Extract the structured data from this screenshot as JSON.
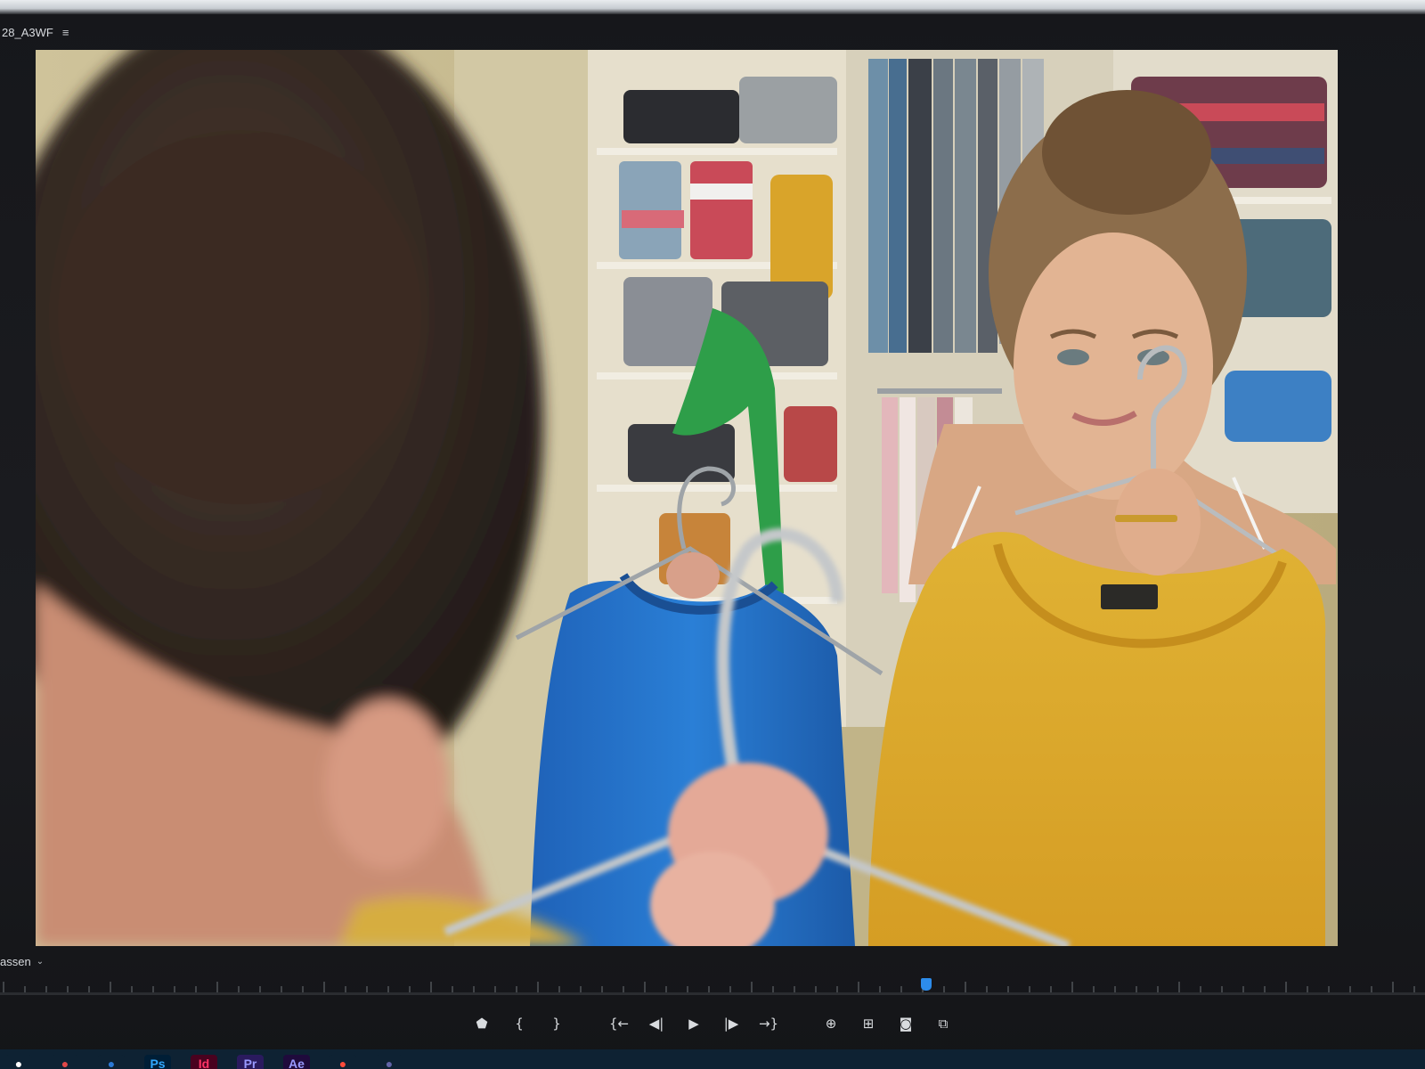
{
  "panel": {
    "sequence_name": "28_A3WF",
    "menu_icon": "hamburger-menu-icon"
  },
  "viewer": {
    "fit_label": "assen",
    "fit_icon": "chevron-down-icon"
  },
  "timeline": {
    "playhead_position": 0.65
  },
  "transport": [
    {
      "name": "add-marker-button",
      "icon": "marker-icon",
      "glyph": "⬟"
    },
    {
      "name": "mark-in-button",
      "icon": "mark-in-icon",
      "glyph": "{"
    },
    {
      "name": "mark-out-button",
      "icon": "mark-out-icon",
      "glyph": "}"
    },
    {
      "name": "go-to-in-button",
      "icon": "go-to-in-icon",
      "glyph": "{←"
    },
    {
      "name": "step-back-button",
      "icon": "step-back-icon",
      "glyph": "◀|"
    },
    {
      "name": "play-button",
      "icon": "play-icon",
      "glyph": "▶"
    },
    {
      "name": "step-forward-button",
      "icon": "step-forward-icon",
      "glyph": "|▶"
    },
    {
      "name": "go-to-out-button",
      "icon": "go-to-out-icon",
      "glyph": "→}"
    },
    {
      "name": "insert-button",
      "icon": "insert-icon",
      "glyph": "⊕"
    },
    {
      "name": "overwrite-button",
      "icon": "overwrite-icon",
      "glyph": "⊞"
    },
    {
      "name": "export-frame-button",
      "icon": "camera-icon",
      "glyph": "◙"
    },
    {
      "name": "comparison-view-button",
      "icon": "comparison-view-icon",
      "glyph": "⧉"
    }
  ],
  "taskbar": {
    "apps": [
      {
        "name": "start-app",
        "icon": "start-icon",
        "label": "",
        "color": "#ffffff",
        "bg": "#0e2233"
      },
      {
        "name": "chrome-app",
        "icon": "chrome-icon",
        "label": "",
        "color": "#e04848",
        "bg": "#0e2233"
      },
      {
        "name": "outlook-app",
        "icon": "outlook-icon",
        "label": "",
        "color": "#2b79d6",
        "bg": "#0e2233"
      },
      {
        "name": "photoshop-app",
        "icon": "photoshop-icon",
        "label": "Ps",
        "color": "#31a8ff",
        "bg": "#001e36"
      },
      {
        "name": "indesign-app",
        "icon": "indesign-icon",
        "label": "Id",
        "color": "#ff3366",
        "bg": "#49021f"
      },
      {
        "name": "premiere-app",
        "icon": "premiere-icon",
        "label": "Pr",
        "color": "#9999ff",
        "bg": "#2a1a5e"
      },
      {
        "name": "aftereffects-app",
        "icon": "aftereffects-icon",
        "label": "Ae",
        "color": "#9999ff",
        "bg": "#1f0a3c"
      },
      {
        "name": "creativecloud-app",
        "icon": "creativecloud-icon",
        "label": "",
        "color": "#ff4b3a",
        "bg": "#0e2233"
      },
      {
        "name": "teams-app",
        "icon": "teams-icon",
        "label": "",
        "color": "#6264a7",
        "bg": "#0e2233"
      }
    ]
  }
}
